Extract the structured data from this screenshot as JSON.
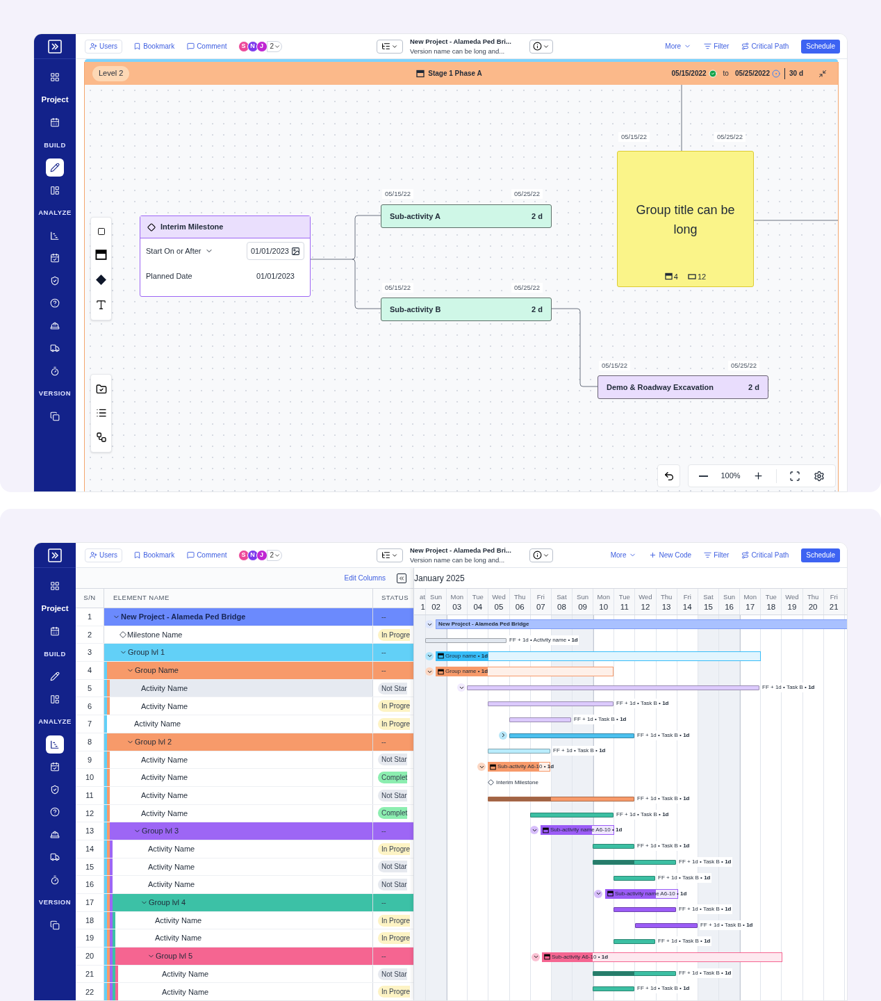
{
  "canvas_view": {
    "toolbar": {
      "links": [
        {
          "label": "Users",
          "kind": "users"
        },
        {
          "label": "Bookmark",
          "kind": "bookmark"
        },
        {
          "label": "Comment",
          "kind": "comment"
        }
      ],
      "avatars": [
        {
          "initial": "S",
          "color": "#ec4899"
        },
        {
          "initial": "N",
          "color": "#7c3aed"
        },
        {
          "initial": "J",
          "color": "#c026d3"
        }
      ],
      "avatar_more": "2",
      "project_title": "New Project - Alameda Ped Bri...",
      "version": "Version name can be long and...",
      "actions": [
        {
          "label": "More",
          "kind": "menu"
        },
        {
          "label": "Filter",
          "kind": "filter"
        },
        {
          "label": "Critical Path",
          "kind": "path"
        }
      ],
      "primary": "Schedule"
    },
    "sidebar": {
      "items": [
        {
          "kind": "button",
          "selected": false
        },
        {
          "kind": "title",
          "text": "Project"
        },
        {
          "kind": "button",
          "selected": false
        },
        {
          "kind": "heading",
          "text": "BUILD"
        },
        {
          "kind": "button",
          "selected": true
        },
        {
          "kind": "button",
          "selected": false
        },
        {
          "kind": "heading",
          "text": "ANALYZE"
        },
        {
          "kind": "button",
          "selected": false
        },
        {
          "kind": "button",
          "selected": false
        },
        {
          "kind": "button",
          "selected": false
        },
        {
          "kind": "button",
          "selected": false
        },
        {
          "kind": "button",
          "selected": false
        },
        {
          "kind": "button",
          "selected": false
        },
        {
          "kind": "button",
          "selected": false
        },
        {
          "kind": "heading",
          "text": "VERSION"
        },
        {
          "kind": "button",
          "selected": false
        }
      ]
    },
    "stage_bar": {
      "level": "Level 2",
      "stage": "Stage 1 Phase A",
      "start": "05/15/2022",
      "to": "to",
      "end": "05/25/2022",
      "duration": "30 d"
    },
    "milestone": {
      "title": "Interim Milestone",
      "rows": [
        {
          "label": "Start On or After",
          "value": "01/01/2023",
          "kind": "dropdown"
        },
        {
          "label": "Planned Date",
          "value": "01/01/2023",
          "kind": "text"
        }
      ]
    },
    "activities": [
      {
        "name": "Sub-activity A",
        "duration": "2 d",
        "start": "05/15/22",
        "end": "05/25/22",
        "color": "#cff7e7"
      },
      {
        "name": "Sub-activity B",
        "duration": "2 d",
        "start": "05/15/22",
        "end": "05/25/22",
        "color": "#cff7e7"
      },
      {
        "name": "Demo & Roadway Excavation",
        "duration": "2 d",
        "start": "05/15/22",
        "end": "05/25/22",
        "color": "#e9ddfd"
      }
    ],
    "group_card": {
      "title": "Group title can be long",
      "start": "05/15/22",
      "end": "05/25/22",
      "counts": [
        {
          "value": "4",
          "kind": "stage"
        },
        {
          "value": "12",
          "kind": "box"
        }
      ]
    },
    "zoom": {
      "value": "100%"
    }
  },
  "gantt_view": {
    "toolbar": {
      "links": [
        {
          "label": "Users",
          "kind": "users"
        },
        {
          "label": "Bookmark",
          "kind": "bookmark"
        },
        {
          "label": "Comment",
          "kind": "comment"
        }
      ],
      "avatars": [
        {
          "initial": "S",
          "color": "#ec4899"
        },
        {
          "initial": "N",
          "color": "#7c3aed"
        },
        {
          "initial": "J",
          "color": "#c026d3"
        }
      ],
      "avatar_more": "2",
      "project_title": "New Project - Alameda Ped Bri...",
      "version": "Version name can be long and...",
      "actions": [
        {
          "label": "More",
          "kind": "menu"
        },
        {
          "label": "New Code",
          "kind": "add"
        },
        {
          "label": "Filter",
          "kind": "filter"
        },
        {
          "label": "Critical Path",
          "kind": "path"
        }
      ],
      "primary": "Schedule"
    },
    "sidebar": {
      "items": [
        {
          "kind": "button",
          "selected": false
        },
        {
          "kind": "title",
          "text": "Project"
        },
        {
          "kind": "button",
          "selected": false
        },
        {
          "kind": "heading",
          "text": "BUILD"
        },
        {
          "kind": "button",
          "selected": false
        },
        {
          "kind": "button",
          "selected": false
        },
        {
          "kind": "heading",
          "text": "ANALYZE"
        },
        {
          "kind": "button",
          "selected": true
        },
        {
          "kind": "button",
          "selected": false
        },
        {
          "kind": "button",
          "selected": false
        },
        {
          "kind": "button",
          "selected": false
        },
        {
          "kind": "button",
          "selected": false
        },
        {
          "kind": "button",
          "selected": false
        },
        {
          "kind": "button",
          "selected": false
        },
        {
          "kind": "heading",
          "text": "VERSION"
        },
        {
          "kind": "button",
          "selected": false
        }
      ]
    },
    "edit_columns": "Edit Columns",
    "table": {
      "columns": [
        "S/N",
        "ELEMENT NAME",
        "STATUS"
      ],
      "rows": [
        {
          "sn": "1",
          "name": "New Project - Alameda Ped Bridge",
          "kind": "project",
          "color": "#6b8afd",
          "status": {
            "text": "--"
          },
          "children": [
            {
              "sn": "2",
              "name": "Milestone Name",
              "kind": "milestone",
              "status": {
                "text": "In Progre",
                "color": "#fdf3c4"
              },
              "selected": false
            },
            {
              "sn": "3",
              "name": "Group lvl 1",
              "kind": "group",
              "color": "#62d0f7",
              "status": {
                "text": "--"
              },
              "children": [
                {
                  "sn": "4",
                  "name": "Group Name",
                  "kind": "group",
                  "color": "#f79a6a",
                  "status": {
                    "text": "--"
                  },
                  "children": [
                    {
                      "sn": "5",
                      "name": "Activity Name",
                      "kind": "activity",
                      "status": {
                        "text": "Not Star",
                        "color": "#e6e9ef"
                      },
                      "selected": true
                    },
                    {
                      "sn": "6",
                      "name": "Activity Name",
                      "kind": "activity",
                      "status": {
                        "text": "In Progre",
                        "color": "#fdf3c4"
                      },
                      "selected": false
                    }
                  ]
                },
                {
                  "sn": "7",
                  "name": "Activity Name",
                  "kind": "activity",
                  "status": {
                    "text": "In Progre",
                    "color": "#fdf3c4"
                  },
                  "selected": false
                },
                {
                  "sn": "8",
                  "name": "Group lvl 2",
                  "kind": "group",
                  "color": "#f79a6a",
                  "status": {
                    "text": "--"
                  },
                  "children": [
                    {
                      "sn": "9",
                      "name": "Activity Name",
                      "kind": "activity",
                      "status": {
                        "text": "Not Star",
                        "color": "#e6e9ef"
                      },
                      "selected": false
                    },
                    {
                      "sn": "10",
                      "name": "Activity Name",
                      "kind": "activity",
                      "status": {
                        "text": "Complet",
                        "color": "#8ceeb0"
                      },
                      "selected": false
                    },
                    {
                      "sn": "11",
                      "name": "Activity Name",
                      "kind": "activity",
                      "status": {
                        "text": "Not Star",
                        "color": "#e6e9ef"
                      },
                      "selected": false
                    },
                    {
                      "sn": "12",
                      "name": "Activity Name",
                      "kind": "activity",
                      "status": {
                        "text": "Complet",
                        "color": "#8ceeb0"
                      },
                      "selected": false
                    },
                    {
                      "sn": "13",
                      "name": "Group lvl 3",
                      "kind": "group",
                      "color": "#9d66f5",
                      "status": {
                        "text": "--"
                      },
                      "children": [
                        {
                          "sn": "14",
                          "name": "Activity Name",
                          "kind": "activity",
                          "status": {
                            "text": "In Progre",
                            "color": "#fdf3c4"
                          },
                          "selected": false
                        },
                        {
                          "sn": "15",
                          "name": "Activity Name",
                          "kind": "activity",
                          "status": {
                            "text": "Not Star",
                            "color": "#e6e9ef"
                          },
                          "selected": false
                        },
                        {
                          "sn": "16",
                          "name": "Activity Name",
                          "kind": "activity",
                          "status": {
                            "text": "Not Star",
                            "color": "#e6e9ef"
                          },
                          "selected": false
                        },
                        {
                          "sn": "17",
                          "name": "Group lvl 4",
                          "kind": "group",
                          "color": "#3cc1a6",
                          "status": {
                            "text": "--"
                          },
                          "children": [
                            {
                              "sn": "18",
                              "name": "Activity Name",
                              "kind": "activity",
                              "status": {
                                "text": "In Progre",
                                "color": "#fdf3c4"
                              },
                              "selected": false
                            },
                            {
                              "sn": "19",
                              "name": "Activity Name",
                              "kind": "activity",
                              "status": {
                                "text": "In Progre",
                                "color": "#fdf3c4"
                              },
                              "selected": false
                            },
                            {
                              "sn": "20",
                              "name": "Group lvl 5",
                              "kind": "group",
                              "color": "#f56591",
                              "status": {
                                "text": "--"
                              },
                              "children": [
                                {
                                  "sn": "21",
                                  "name": "Activity Name",
                                  "kind": "activity",
                                  "status": {
                                    "text": "Not Star",
                                    "color": "#e6e9ef"
                                  },
                                  "selected": false
                                },
                                {
                                  "sn": "22",
                                  "name": "Activity Name",
                                  "kind": "activity",
                                  "status": {
                                    "text": "In Progre",
                                    "color": "#fdf3c4"
                                  },
                                  "selected": false
                                }
                              ]
                            }
                          ]
                        }
                      ]
                    }
                  ]
                }
              ]
            }
          ]
        }
      ]
    },
    "timeline": {
      "month": "January 2025",
      "days": [
        {
          "weekday": "at",
          "day": "1",
          "weekend": true
        },
        {
          "weekday": "Sun",
          "day": "02",
          "weekend": true
        },
        {
          "weekday": "Mon",
          "day": "03",
          "weekend": false
        },
        {
          "weekday": "Tue",
          "day": "04",
          "weekend": false
        },
        {
          "weekday": "Wed",
          "day": "05",
          "weekend": false
        },
        {
          "weekday": "Thu",
          "day": "06",
          "weekend": false
        },
        {
          "weekday": "Fri",
          "day": "07",
          "weekend": false
        },
        {
          "weekday": "Sat",
          "day": "08",
          "weekend": true
        },
        {
          "weekday": "Sun",
          "day": "09",
          "weekend": true
        },
        {
          "weekday": "Mon",
          "day": "10",
          "weekend": false
        },
        {
          "weekday": "Tue",
          "day": "11",
          "weekend": false
        },
        {
          "weekday": "Wed",
          "day": "12",
          "weekend": false
        },
        {
          "weekday": "Thu",
          "day": "13",
          "weekend": false
        },
        {
          "weekday": "Fri",
          "day": "14",
          "weekend": false
        },
        {
          "weekday": "Sat",
          "day": "15",
          "weekend": true
        },
        {
          "weekday": "Sun",
          "day": "16",
          "weekend": true
        },
        {
          "weekday": "Mon",
          "day": "17",
          "weekend": false
        },
        {
          "weekday": "Tue",
          "day": "18",
          "weekend": false
        },
        {
          "weekday": "Wed",
          "day": "19",
          "weekend": false
        },
        {
          "weekday": "Thu",
          "day": "20",
          "weekend": false
        },
        {
          "weekday": "Fri",
          "day": "21",
          "weekend": false
        }
      ],
      "bars": [
        {
          "kind": "project",
          "label": "New Project - Alameda Ped Bridge",
          "color": "#a9c1ff",
          "expanded": true
        },
        {
          "kind": "task",
          "label": "FF + 1d • Activity name • **1d**",
          "color": "#e2e8f0"
        },
        {
          "kind": "group",
          "label": "Group name • **1d**",
          "color": "#38bdf8",
          "expanded": true,
          "level": 0.16
        },
        {
          "kind": "group",
          "label": "Group name • **1d**",
          "color": "#f79a6a",
          "expanded": true,
          "level": 0.29
        },
        {
          "kind": "task",
          "label": "FF + 1d • Task B • **1d**",
          "color": "#dccafd",
          "expanded": true
        },
        {
          "kind": "task",
          "label": "FF + 1d • Task B • **1d**",
          "color": "#dccafd"
        },
        {
          "kind": "task",
          "label": "FF + 1d • Task B • **1d**",
          "color": "#dccafd"
        },
        {
          "kind": "task",
          "label": "FF + 1d • Task B • **1d**",
          "color": "#4cc0ee",
          "expanded": false
        },
        {
          "kind": "task",
          "label": "FF + 1d • Task B • **1d**",
          "color": "#b9ecfc"
        },
        {
          "kind": "group",
          "label": "Sub-activity A6-10 • **1d**",
          "color": "#f79a6a",
          "expanded": true,
          "level": 0.83
        },
        {
          "kind": "milestone",
          "label": "Interim Milestone"
        },
        {
          "kind": "task",
          "label": "FF + 1d • Task B • **1d**",
          "color": "#f79a6a",
          "level": 0.43
        },
        {
          "kind": "task",
          "label": "FF + 1d • Task B • **1d**",
          "color": "#3cbfa3"
        },
        {
          "kind": "group",
          "label": "Sub-activity name A6-10 • **1d**",
          "color": "#9b5cf6",
          "expanded": true,
          "level": 0.7
        },
        {
          "kind": "task",
          "label": "FF + 1d • Task B • **1d**",
          "color": "#3cbfa3"
        },
        {
          "kind": "task",
          "label": "FF + 1d • Task B • **1d**",
          "color": "#3cbfa3",
          "level": 0.5
        },
        {
          "kind": "task",
          "label": "FF + 1d • Task B • **1d**",
          "color": "#3cbfa3"
        },
        {
          "kind": "group",
          "label": "Sub-activity name A6-10 • **1d**",
          "color": "#9b5cf6",
          "expanded": true,
          "level": 0.7
        },
        {
          "kind": "task",
          "label": "FF + 1d • Task B • **1d**",
          "color": "#9b5cf6"
        },
        {
          "kind": "task",
          "label": "FF + 1d • Task B • **1d**",
          "color": "#9b5cf6"
        },
        {
          "kind": "task",
          "label": "FF + 1d • Task B • **1d**",
          "color": "#3cbfa3"
        },
        {
          "kind": "group",
          "label": "Sub-activity A6-10 • **1d**",
          "color": "#f56591",
          "expanded": true,
          "level": 0.21
        },
        {
          "kind": "task",
          "label": "FF + 1d • Task B • **1d**",
          "color": "#3cbfa3",
          "level": 0.5
        },
        {
          "kind": "task",
          "label": "FF + 1d • Task B • **1d**",
          "color": "#3cbfa3"
        }
      ]
    }
  }
}
